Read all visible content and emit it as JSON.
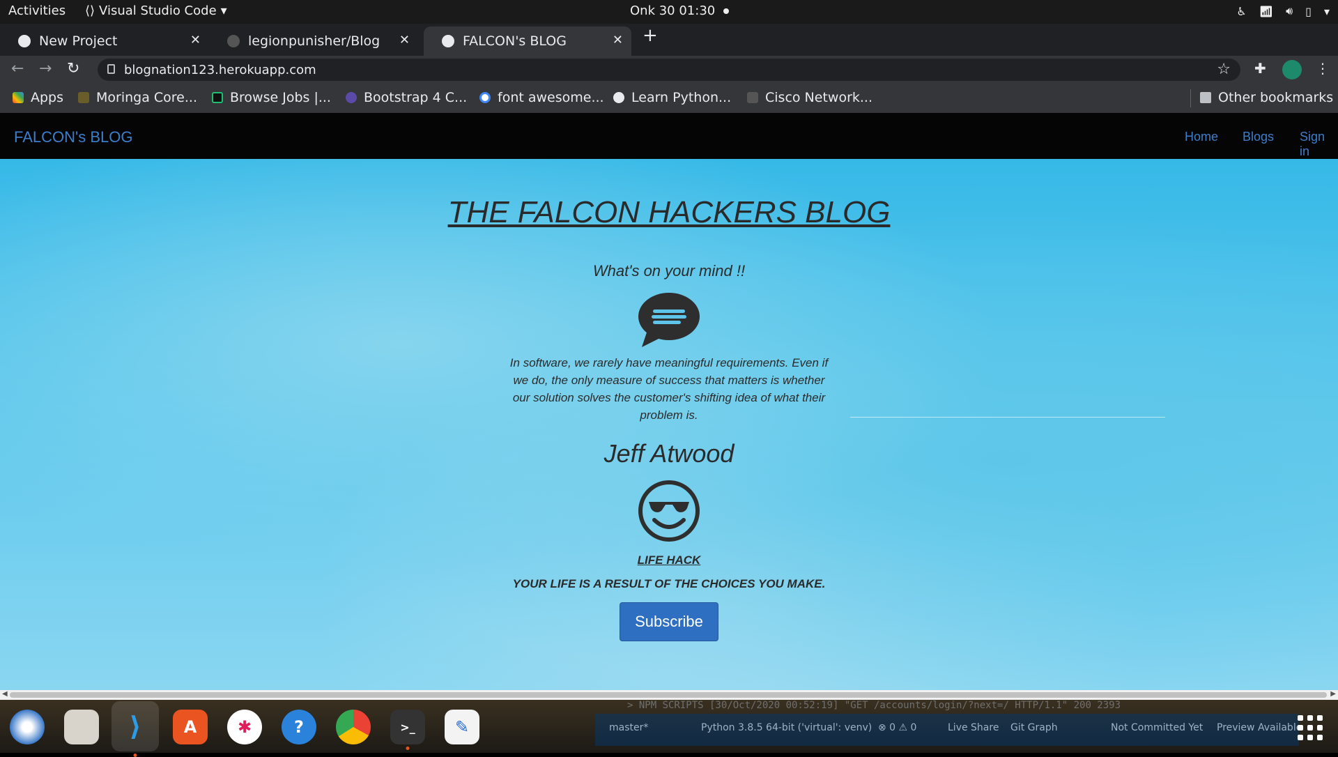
{
  "system": {
    "activities": "Activities",
    "app_name": "Visual Studio Code",
    "clock": "Onk 30  01:30"
  },
  "browser": {
    "tabs": [
      {
        "title": "New Project"
      },
      {
        "title": "legionpunisher/Blog"
      },
      {
        "title": "FALCON's BLOG",
        "active": true
      }
    ],
    "url": "blognation123.herokuapp.com",
    "bookmarks": [
      {
        "label": "Apps"
      },
      {
        "label": "Moringa Core..."
      },
      {
        "label": "Browse Jobs |..."
      },
      {
        "label": "Bootstrap 4 C..."
      },
      {
        "label": "font awesome..."
      },
      {
        "label": "Learn Python..."
      },
      {
        "label": "Cisco Network..."
      }
    ],
    "other_bookmarks": "Other bookmarks"
  },
  "site": {
    "brand": "FALCON's BLOG",
    "nav": [
      "Home",
      "Blogs",
      "Sign in"
    ],
    "hero_title": "THE FALCON HACKERS BLOG",
    "prompt": "What's on your mind !!",
    "quote": "In software, we rarely have meaningful requirements. Even if we do, the only measure of success that matters is whether our solution solves the customer's shifting idea of what their problem is.",
    "author": "Jeff Atwood",
    "lifehack_title": "LIFE HACK",
    "motto": "YOUR LIFE IS A RESULT OF THE CHOICES YOU MAKE.",
    "subscribe_label": "Subscribe",
    "icons": [
      "comment-lines-icon",
      "sunglasses-smile-icon"
    ]
  },
  "vscode": {
    "panel_line": "> NPM SCRIPTS          [30/Oct/2020 00:52:19] \"GET /accounts/login/?next=/ HTTP/1.1\" 200 2393",
    "status": {
      "branch": "master*",
      "python": "Python 3.8.5 64-bit ('virtual': venv)",
      "problems": "⊗ 0 ⚠ 0",
      "live_share": "Live Share",
      "git_graph": "Git Graph",
      "commit": "Not Committed Yet",
      "preview": "Preview Available"
    }
  },
  "dock": [
    "thunderbird",
    "files",
    "vscode",
    "software",
    "slack",
    "help",
    "chrome",
    "terminal",
    "text-editor"
  ],
  "colors": {
    "site_link": "#3d7ecb",
    "subscribe": "#2f6fc2",
    "page_bg": "#4fc2ea"
  }
}
